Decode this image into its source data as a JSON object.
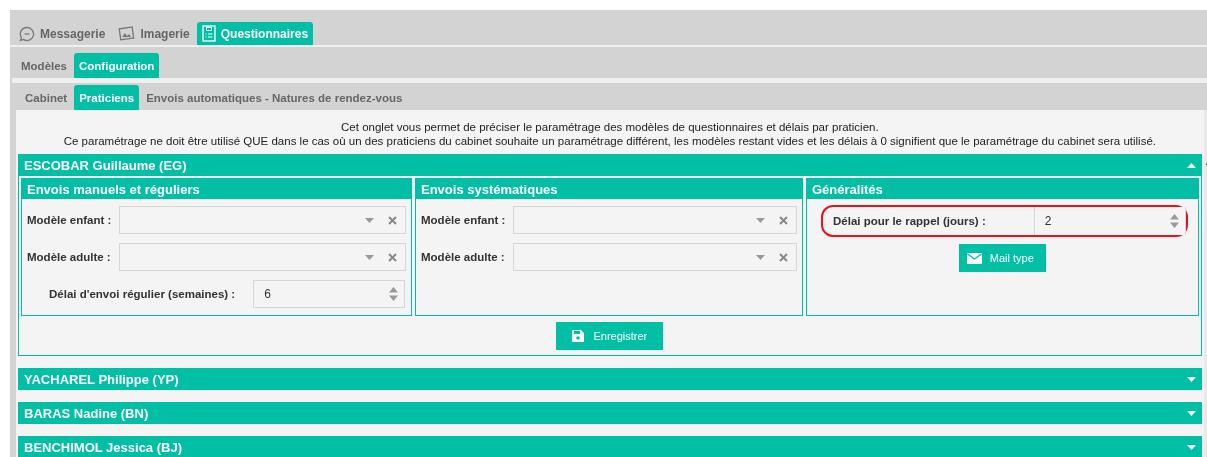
{
  "main_tabs": [
    {
      "label": "Messagerie",
      "selected": false
    },
    {
      "label": "Imagerie",
      "selected": false
    },
    {
      "label": "Questionnaires",
      "selected": true
    }
  ],
  "sub_tabs": [
    {
      "label": "Modèles",
      "selected": false
    },
    {
      "label": "Configuration",
      "selected": true
    }
  ],
  "section_tabs": [
    {
      "label": "Cabinet",
      "selected": false
    },
    {
      "label": "Praticiens",
      "selected": true
    },
    {
      "label": "Envois automatiques - Natures de rendez-vous",
      "selected": false
    }
  ],
  "intro": [
    "Cet onglet vous permet de préciser le paramétrage des modèles de questionnaires et délais par praticien.",
    "Ce paramétrage ne doit être utilisé QUE dans le cas où un des praticiens du cabinet souhaite un paramétrage différent, les modèles restant vides et les délais à 0 signifient que le paramétrage du cabinet sera utilisé."
  ],
  "practitioners": [
    {
      "name": "ESCOBAR Guillaume (EG)",
      "expanded": true,
      "groups": [
        {
          "title": "Envois manuels et réguliers",
          "fields": [
            {
              "kind": "select",
              "label": "Modèle enfant :",
              "highlighted": false
            },
            {
              "kind": "select",
              "label": "Modèle adulte :",
              "highlighted": false
            },
            {
              "kind": "number",
              "label": "Délai d'envoi régulier (semaines) :",
              "value": "6",
              "highlighted": false
            }
          ]
        },
        {
          "title": "Envois systématiques",
          "fields": [
            {
              "kind": "select",
              "label": "Modèle enfant :",
              "highlighted": false
            },
            {
              "kind": "select",
              "label": "Modèle adulte :",
              "highlighted": false
            }
          ]
        },
        {
          "title": "Généralités",
          "fields": [
            {
              "kind": "number",
              "label": "Délai pour le rappel (jours) :",
              "value": "2",
              "highlighted": true
            },
            {
              "kind": "button",
              "label": "Mail type",
              "highlighted": false
            }
          ]
        }
      ],
      "save_button": "Enregistrer"
    },
    {
      "name": "YACHAREL Philippe (YP)",
      "expanded": false
    },
    {
      "name": "BARAS Nadine (BN)",
      "expanded": false
    },
    {
      "name": "BENCHIMOL Jessica (BJ)",
      "expanded": false
    }
  ]
}
